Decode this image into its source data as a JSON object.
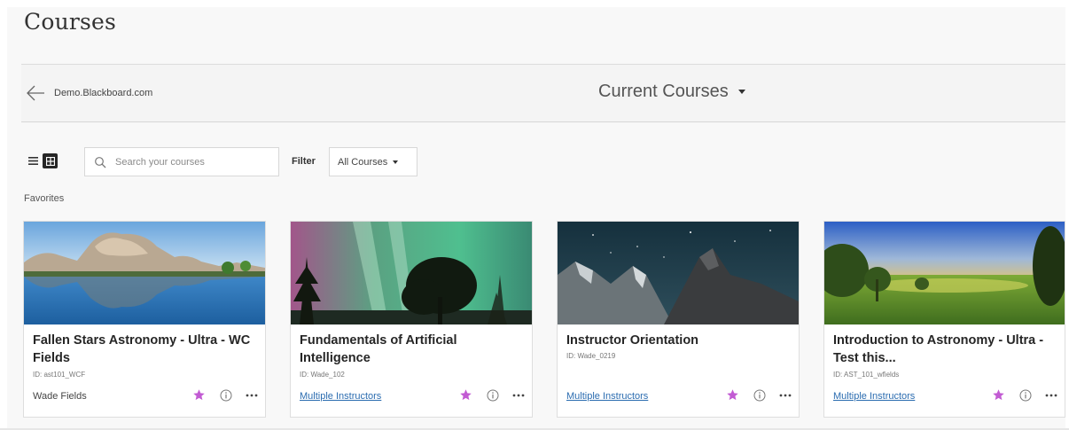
{
  "page": {
    "title": "Courses"
  },
  "header": {
    "back_label": "Demo.Blackboard.com",
    "title": "Current Courses"
  },
  "controls": {
    "search_placeholder": "Search your courses",
    "filter_label": "Filter",
    "filter_value": "All Courses"
  },
  "section": {
    "favorites_label": "Favorites"
  },
  "courses": [
    {
      "title": "Fallen Stars Astronomy - Ultra - WC Fields",
      "id": "ID: ast101_WCF",
      "instructor": "Wade Fields",
      "instructor_is_link": false,
      "favorite": true
    },
    {
      "title": "Fundamentals of Artificial Intelligence",
      "id": "ID: Wade_102",
      "instructor": "Multiple Instructors",
      "instructor_is_link": true,
      "favorite": true
    },
    {
      "title": "Instructor Orientation",
      "id": "ID: Wade_0219",
      "instructor": "Multiple Instructors",
      "instructor_is_link": true,
      "favorite": true
    },
    {
      "title": "Introduction to Astronomy - Ultra - Test this...",
      "id": "ID: AST_101_wfields",
      "instructor": "Multiple Instructors",
      "instructor_is_link": true,
      "favorite": true
    }
  ],
  "colors": {
    "favorite_star": "#c25bd3",
    "link": "#2b6cb0",
    "grid_view_active": "#262626"
  }
}
